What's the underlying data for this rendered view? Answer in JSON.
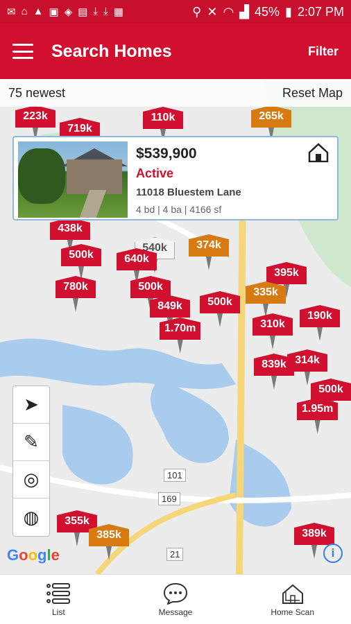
{
  "status_bar": {
    "battery": "45%",
    "time": "2:07 PM"
  },
  "app_bar": {
    "title": "Search Homes",
    "filter_label": "Filter"
  },
  "map_bar": {
    "count_label": "75 newest",
    "reset_label": "Reset Map"
  },
  "popup": {
    "price": "$539,900",
    "status": "Active",
    "address": "11018 Bluestem Lane",
    "specs": "4 bd | 4 ba | 4166 sf"
  },
  "pins": [
    {
      "label": "223k",
      "color": "red"
    },
    {
      "label": "719k",
      "color": "red"
    },
    {
      "label": "110k",
      "color": "red"
    },
    {
      "label": "265k",
      "color": "orange"
    },
    {
      "label": "438k",
      "color": "red"
    },
    {
      "label": "500k",
      "color": "red"
    },
    {
      "label": "540k",
      "color": "grey"
    },
    {
      "label": "374k",
      "color": "orange"
    },
    {
      "label": "640k",
      "color": "red"
    },
    {
      "label": "780k",
      "color": "red"
    },
    {
      "label": "500k",
      "color": "red"
    },
    {
      "label": "849k",
      "color": "red"
    },
    {
      "label": "1.70m",
      "color": "red"
    },
    {
      "label": "500k",
      "color": "red"
    },
    {
      "label": "395k",
      "color": "red"
    },
    {
      "label": "335k",
      "color": "orange"
    },
    {
      "label": "190k",
      "color": "red"
    },
    {
      "label": "310k",
      "color": "red"
    },
    {
      "label": "839k",
      "color": "red"
    },
    {
      "label": "314k",
      "color": "red"
    },
    {
      "label": "500k",
      "color": "red"
    },
    {
      "label": "1.95m",
      "color": "red"
    },
    {
      "label": "355k",
      "color": "red"
    },
    {
      "label": "385k",
      "color": "orange"
    },
    {
      "label": "389k",
      "color": "red"
    }
  ],
  "road_labels": [
    "101",
    "169",
    "21"
  ],
  "google_label": "Google",
  "nav": {
    "list": "List",
    "message": "Message",
    "home_scan": "Home Scan"
  }
}
